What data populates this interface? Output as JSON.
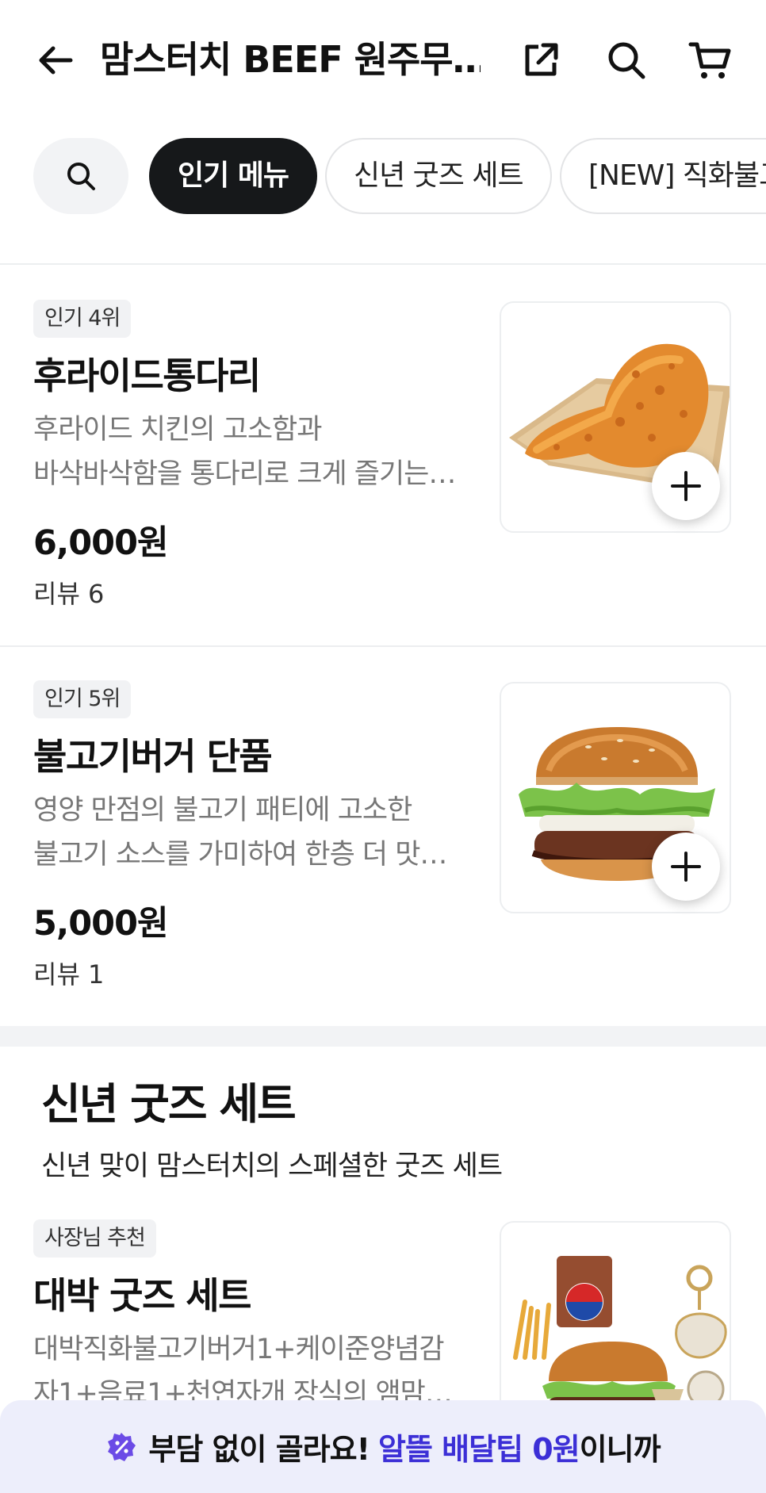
{
  "header": {
    "store_title": "맘스터치 BEEF 원주무…",
    "icons": [
      "back-arrow-icon",
      "share-icon",
      "search-icon",
      "cart-icon"
    ]
  },
  "tabs": [
    {
      "label": "인기 메뉴",
      "active": true
    },
    {
      "label": "신년 굿즈 세트",
      "active": false
    },
    {
      "label": "[NEW] 직화불고",
      "active": false
    }
  ],
  "items": [
    {
      "badge": "인기 4위",
      "name": "후라이드통다리",
      "desc_line1": "후라이드 치킨의 고소함과",
      "desc_line2": "바삭바삭함을 통다리로 크게 즐기는…",
      "price": "6,000원",
      "review": "리뷰 6"
    },
    {
      "badge": "인기 5위",
      "name": "불고기버거 단품",
      "desc_line1": "영양 만점의 불고기 패티에 고소한",
      "desc_line2": "불고기 소스를 가미하여 한층 더 맛…",
      "price": "5,000원",
      "review": "리뷰 1"
    },
    {
      "badge": "사장님 추천",
      "name": "대박 굿즈 세트",
      "desc_line1": "대박직화불고기버거1+케이준양념감",
      "desc_line2": "자1+음료1+천연자개 장식의 앰맘…"
    }
  ],
  "section": {
    "title": "신년 굿즈 세트",
    "subtitle": "신년 맞이 맘스터치의 스페셜한 굿즈 세트"
  },
  "banner": {
    "text_before": "부담 없이 골라요! ",
    "accent": "알뜰 배달팁 0원",
    "text_after": "이니까"
  },
  "colors": {
    "accent": "#3c2fd6",
    "active_tab": "#16181a",
    "banner_bg": "#edeefb"
  }
}
